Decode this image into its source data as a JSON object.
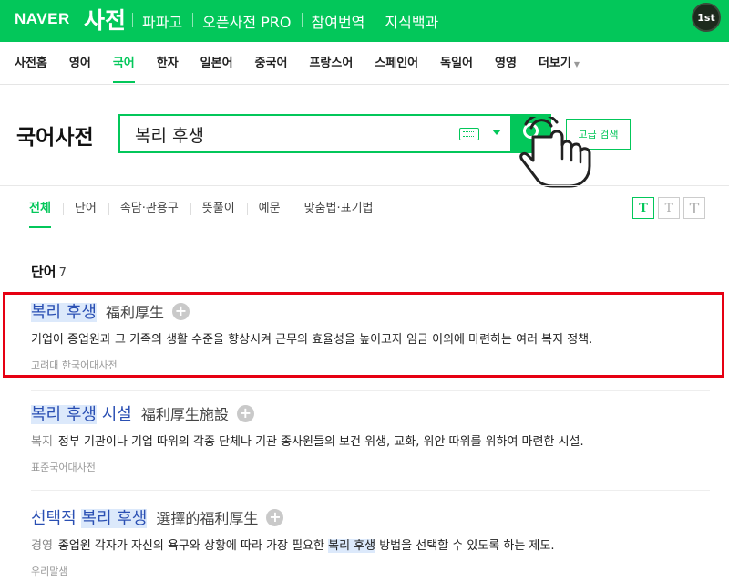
{
  "topbar": {
    "brand": "NAVER",
    "service": "사전",
    "nav": [
      "파파고",
      "오픈사전 PRO",
      "참여번역",
      "지식백과"
    ],
    "avatar": "1st"
  },
  "categories": {
    "items": [
      "사전홈",
      "영어",
      "국어",
      "한자",
      "일본어",
      "중국어",
      "프랑스어",
      "스페인어",
      "독일어",
      "영영",
      "더보기"
    ],
    "active": "국어"
  },
  "search": {
    "dict_title": "국어사전",
    "query": "복리 후생",
    "advanced_label": "고급 검색"
  },
  "tabs": {
    "items": [
      "전체",
      "단어",
      "속담·관용구",
      "뜻풀이",
      "예문",
      "맞춤법·표기법"
    ],
    "active": "전체"
  },
  "font_sizes": [
    "T",
    "T",
    "T"
  ],
  "section": {
    "title": "단어",
    "count": "7"
  },
  "entries": [
    {
      "term_hl": "복리 후생",
      "term_rest": "",
      "term_prefix": "",
      "hanja": "福利厚生",
      "field": "",
      "meaning": "기업이 종업원과 그 가족의 생활 수준을 향상시켜 근무의 효율성을 높이고자 임금 이외에 마련하는 여러 복지 정책.",
      "source": "고려대 한국어대사전"
    },
    {
      "term_hl": "복리 후생",
      "term_rest": " 시설",
      "term_prefix": "",
      "hanja": "福利厚生施設",
      "field": "복지",
      "meaning": "정부 기관이나 기업 따위의 각종 단체나 기관 종사원들의 보건 위생, 교화, 위안 따위를 위하여 마련한 시설.",
      "source": "표준국어대사전"
    },
    {
      "term_hl": "복리 후생",
      "term_rest": "",
      "term_prefix": "선택적 ",
      "hanja": "選擇的福利厚生",
      "field": "경영",
      "meaning_a": "종업원 각자가 자신의 욕구와 상황에 따라 가장 필요한 ",
      "meaning_hl": "복리 후생",
      "meaning_b": " 방법을 선택할 수 있도록 하는 제도.",
      "source": "우리말샘"
    }
  ],
  "colors": {
    "naver_green": "#03c75a",
    "link_blue": "#2a4fb3",
    "highlight": "#dce9fb",
    "annotation_red": "#e60012"
  }
}
